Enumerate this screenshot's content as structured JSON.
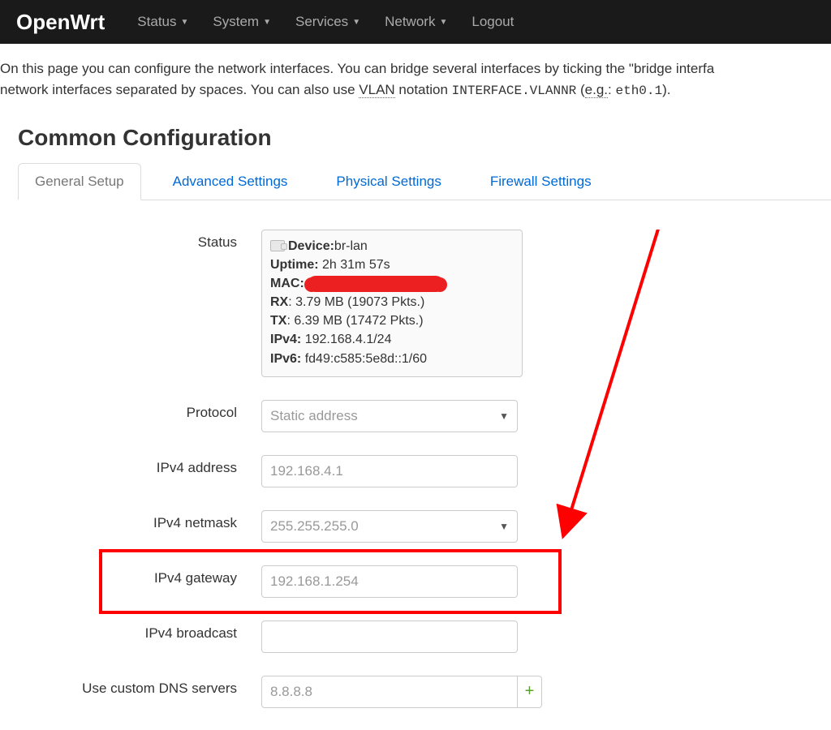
{
  "navbar": {
    "brand": "OpenWrt",
    "items": [
      "Status",
      "System",
      "Services",
      "Network"
    ],
    "logout": "Logout"
  },
  "desc": {
    "p1a": "On this page you can configure the network interfaces. You can bridge several interfaces by ticking the \"bridge interfa",
    "p2a": "network interfaces separated by spaces. You can also use ",
    "vlan_abbr": "VLAN",
    "p2b": " notation ",
    "code1": "INTERFACE.VLANNR",
    "p2c": " (",
    "eg_abbr": "e.g.",
    "p2d": ": ",
    "code2": "eth0.1",
    "p2e": ")."
  },
  "section_title": "Common Configuration",
  "tabs": {
    "general": "General Setup",
    "advanced": "Advanced Settings",
    "physical": "Physical Settings",
    "firewall": "Firewall Settings"
  },
  "labels": {
    "status": "Status",
    "protocol": "Protocol",
    "ipv4_addr": "IPv4 address",
    "ipv4_netmask": "IPv4 netmask",
    "ipv4_gateway": "IPv4 gateway",
    "ipv4_broadcast": "IPv4 broadcast",
    "dns": "Use custom DNS servers"
  },
  "status": {
    "device_l": "Device:",
    "device_v": " br-lan",
    "uptime_l": "Uptime:",
    "uptime_v": " 2h 31m 57s",
    "mac_l": "MAC:",
    "rx_l": "RX",
    "rx_v": ": 3.79 MB (19073 Pkts.)",
    "tx_l": "TX",
    "tx_v": ": 6.39 MB (17472 Pkts.)",
    "ipv4_l": "IPv4:",
    "ipv4_v": " 192.168.4.1/24",
    "ipv6_l": "IPv6:",
    "ipv6_v": " fd49:c585:5e8d::1/60"
  },
  "values": {
    "protocol": "Static address",
    "ipv4_addr": "192.168.4.1",
    "ipv4_netmask": "255.255.255.0",
    "ipv4_gateway": "192.168.1.254",
    "ipv4_broadcast": "",
    "dns": "8.8.8.8"
  }
}
